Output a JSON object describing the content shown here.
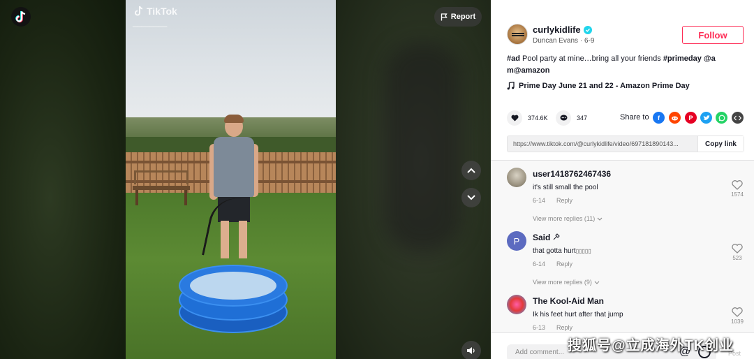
{
  "video": {
    "watermark_brand": "TikTok",
    "report_label": "Report"
  },
  "author": {
    "username": "curlykidlife",
    "display_name": "Duncan Evans",
    "date": "6-9",
    "follow_label": "Follow"
  },
  "caption": {
    "tag": "#ad",
    "text": "Pool party at mine…bring all your friends",
    "hashtag": "#primeday",
    "mention_a": "@a",
    "mention_b": "m@amazon"
  },
  "music": {
    "title": "Prime Day June 21 and 22 - Amazon Prime Day"
  },
  "stats": {
    "likes": "374.6K",
    "comments": "347",
    "share_label": "Share to"
  },
  "share_targets": [
    "facebook-icon",
    "reddit-icon",
    "pinterest-icon",
    "twitter-icon",
    "whatsapp-icon",
    "embed-icon"
  ],
  "link": {
    "url": "https://www.tiktok.com/@curlykidlife/video/697181890143...",
    "copy_label": "Copy link"
  },
  "comments": [
    {
      "user": "user1418762467436",
      "text": "it's still small the pool",
      "date": "6-14",
      "reply_label": "Reply",
      "likes": "1574",
      "more_replies": "View more replies (11)"
    },
    {
      "user": "Said",
      "avatar_letter": "P",
      "text": "that gotta hurt",
      "date": "6-14",
      "reply_label": "Reply",
      "likes": "523",
      "more_replies": "View more replies (9)"
    },
    {
      "user": "The Kool-Aid Man",
      "text": "Ik his feet hurt after that jump",
      "date": "6-13",
      "reply_label": "Reply",
      "likes": "1039"
    }
  ],
  "comment_bar": {
    "placeholder": "Add comment...",
    "post_label": "Post"
  },
  "overlay": {
    "site_watermark": "搜狐号@立成海外TK创业"
  },
  "colors": {
    "brand_red": "#fe2c55",
    "verified": "#20d5ec",
    "facebook": "#1877f2",
    "reddit": "#ff4500",
    "pinterest": "#e60023",
    "twitter": "#1da1f2",
    "whatsapp": "#25d366",
    "embed": "#444444"
  }
}
